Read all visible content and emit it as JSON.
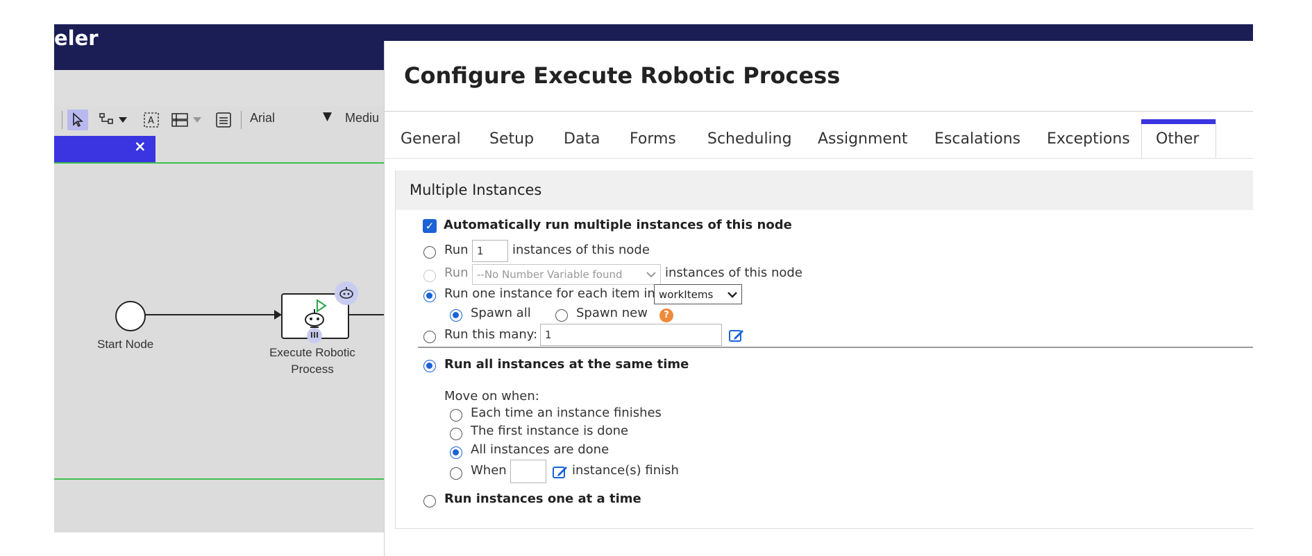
{
  "app": {
    "title_fragment": "eler",
    "toolbar": {
      "font": "Arial",
      "size": "Mediu"
    },
    "canvas": {
      "start_node_label": "Start Node",
      "task_label_line1": "Execute Robotic",
      "task_label_line2": "Process",
      "task_mi_marker": "III"
    }
  },
  "dialog": {
    "title": "Configure Execute Robotic Process",
    "tabs": [
      "General",
      "Setup",
      "Data",
      "Forms",
      "Scheduling",
      "Assignment",
      "Escalations",
      "Exceptions",
      "Other"
    ],
    "active_tab": "Other",
    "section": {
      "title": "Multiple Instances",
      "auto_run_label": "Automatically run multiple instances of this node",
      "run_label": "Run",
      "run_count_value": "1",
      "instances_of_node": "instances of this node",
      "no_number_var": "--No Number Variable found",
      "run_each_item": "Run one instance for each item in",
      "work_items": "workItems",
      "spawn_all": "Spawn all",
      "spawn_new": "Spawn new",
      "run_this_many": "Run this many:",
      "run_this_many_value": "1",
      "run_all_same_time": "Run all instances at the same time",
      "move_on_when": "Move on when:",
      "each_time": "Each time an instance finishes",
      "first_done": "The first instance is done",
      "all_done": "All instances are done",
      "when": "When",
      "when_value": "",
      "instances_finish": "instance(s) finish",
      "one_at_a_time": "Run instances one at a time"
    }
  },
  "colors": {
    "header_navy": "#1b1e55",
    "accent_blue": "#3a35e0",
    "radio_blue": "#1a62d6",
    "flow_green": "#3cbf4c"
  }
}
